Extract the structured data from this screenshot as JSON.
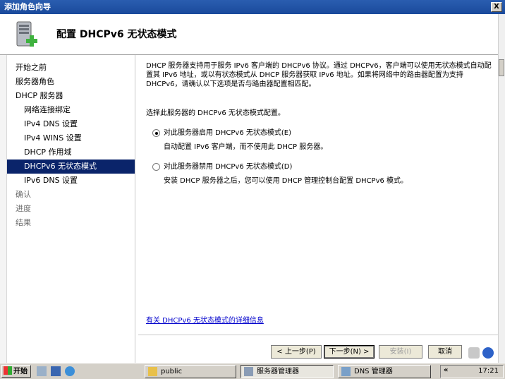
{
  "window": {
    "title": "添加角色向导",
    "close_glyph": "X"
  },
  "header": {
    "title": "配置 DHCPv6 无状态模式",
    "icon": "server-add-icon"
  },
  "sidebar": {
    "items": [
      {
        "label": "开始之前",
        "level": 0,
        "state": "normal"
      },
      {
        "label": "服务器角色",
        "level": 0,
        "state": "normal"
      },
      {
        "label": "DHCP 服务器",
        "level": 0,
        "state": "normal"
      },
      {
        "label": "网络连接绑定",
        "level": 1,
        "state": "normal"
      },
      {
        "label": "IPv4 DNS 设置",
        "level": 1,
        "state": "normal"
      },
      {
        "label": "IPv4 WINS 设置",
        "level": 1,
        "state": "normal"
      },
      {
        "label": "DHCP 作用域",
        "level": 1,
        "state": "normal"
      },
      {
        "label": "DHCPv6 无状态模式",
        "level": 1,
        "state": "active"
      },
      {
        "label": "IPv6 DNS 设置",
        "level": 1,
        "state": "normal"
      },
      {
        "label": "确认",
        "level": 0,
        "state": "dim"
      },
      {
        "label": "进度",
        "level": 0,
        "state": "dim"
      },
      {
        "label": "结果",
        "level": 0,
        "state": "dim"
      }
    ]
  },
  "content": {
    "description": "DHCP 服务器支持用于服务 IPv6 客户端的 DHCPv6 协议。通过 DHCPv6，客户端可以使用无状态模式自动配置其 IPv6 地址，或以有状态模式从 DHCP 服务器获取 IPv6 地址。如果将网络中的路由器配置为支持 DHCPv6，请确认以下选项是否与路由器配置相匹配。",
    "prompt": "选择此服务器的 DHCPv6 无状态模式配置。",
    "option_enable": {
      "label": "对此服务器启用 DHCPv6 无状态模式(E)",
      "detail": "自动配置 IPv6 客户端，而不使用此 DHCP 服务器。",
      "selected": true
    },
    "option_disable": {
      "label": "对此服务器禁用 DHCPv6 无状态模式(D)",
      "detail": "安装 DHCP 服务器之后，您可以使用 DHCP 管理控制台配置 DHCPv6 模式。",
      "selected": false
    },
    "more_link": "有关 DHCPv6 无状态模式的详细信息"
  },
  "buttons": {
    "back": "< 上一步(P)",
    "next": "下一步(N) >",
    "install": "安装(I)",
    "cancel": "取消"
  },
  "taskbar": {
    "start": "开始",
    "tasks": [
      {
        "label": "public",
        "icon": "folder-icon"
      },
      {
        "label": "服务器管理器",
        "icon": "server-manager-icon"
      },
      {
        "label": "DNS 管理器",
        "icon": "dns-icon"
      }
    ],
    "clock": "17:21",
    "chevron": "«"
  },
  "colors": {
    "title_bar": "#1a4a9c",
    "nav_active": "#0a246a",
    "link": "#0000cc"
  }
}
